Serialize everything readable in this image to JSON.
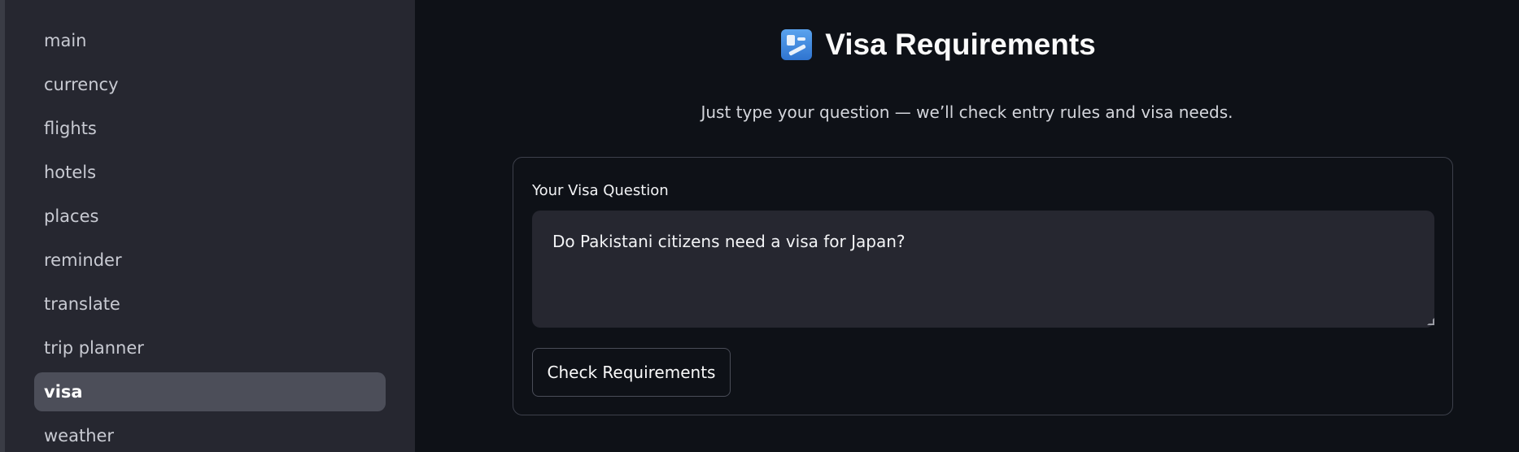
{
  "sidebar": {
    "items": [
      {
        "label": "main"
      },
      {
        "label": "currency"
      },
      {
        "label": "flights"
      },
      {
        "label": "hotels"
      },
      {
        "label": "places"
      },
      {
        "label": "reminder"
      },
      {
        "label": "translate"
      },
      {
        "label": "trip planner"
      },
      {
        "label": "visa",
        "active": true
      },
      {
        "label": "weather"
      }
    ]
  },
  "main": {
    "title": "Visa Requirements",
    "title_icon": "passport-control-icon",
    "subtitle": "Just type your question — we’ll check entry rules and visa needs.",
    "form": {
      "field_label": "Your Visa Question",
      "question_value": "Do Pakistani citizens need a visa for Japan?",
      "submit_label": "Check Requirements"
    }
  },
  "colors": {
    "background": "#0e1117",
    "sidebar": "#262730",
    "active_item": "#4c4e59",
    "card_border": "#3d404b",
    "input_bg": "#262730"
  }
}
